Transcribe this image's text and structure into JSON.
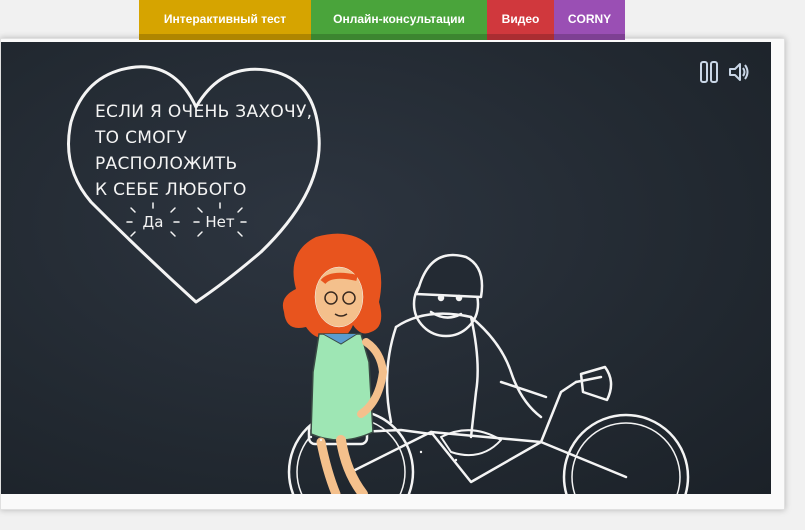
{
  "nav": {
    "tabs": [
      {
        "label": "Интерактивный тест",
        "color": "#d6a400"
      },
      {
        "label": "Онлайн-консультации",
        "color": "#4aa43b"
      },
      {
        "label": "Видео",
        "color": "#d0383d"
      },
      {
        "label": "CORNY",
        "color": "#9a4fb4"
      }
    ]
  },
  "board": {
    "background": "#232a33",
    "chalk_color": "#f4f4f4",
    "controls": {
      "pause_icon": "pause-icon",
      "sound_icon": "speaker-icon"
    },
    "question": {
      "line1": "Если я очень захочу,",
      "line2": "то смогу расположить",
      "line3": "к себе любого"
    },
    "answers": {
      "yes": "Да",
      "no": "Нет"
    },
    "illustration": {
      "girl_hair_color": "#e8541e",
      "girl_dress_color": "#9ee6b4",
      "scene": "girl-and-man-on-bicycle"
    }
  }
}
